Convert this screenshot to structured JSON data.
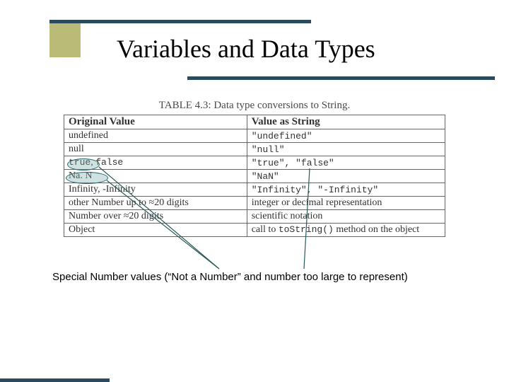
{
  "slide": {
    "title": "Variables and Data Types",
    "table_caption": "TABLE 4.3: Data type conversions to String.",
    "headers": {
      "col1": "Original Value",
      "col2": "Value as String"
    },
    "rows": [
      {
        "c1": "undefined",
        "c2": "\"undefined\""
      },
      {
        "c1": "null",
        "c2": "\"null\""
      },
      {
        "c1_a": "true",
        "c1_sep": ", ",
        "c1_b": "false",
        "c2": "\"true\", \"false\""
      },
      {
        "c1": "Na. N",
        "c2": "\"NaN\""
      },
      {
        "c1_a": "Infinity",
        "c1_sep": ", ",
        "c1_b": "-Infinity",
        "c2": "\"Infinity\", \"-Infinity\""
      },
      {
        "c1": "other Number up to ≈20 digits",
        "c2": "integer or decimal representation"
      },
      {
        "c1": "Number over ≈20 digits",
        "c2": "scientific notation"
      },
      {
        "c1": "Object",
        "c2_pre": "call to ",
        "c2_mono": "toString()",
        "c2_post": " method on the object"
      }
    ],
    "annotation": "Special Number values (“Not a Number” and number too large to represent)"
  }
}
